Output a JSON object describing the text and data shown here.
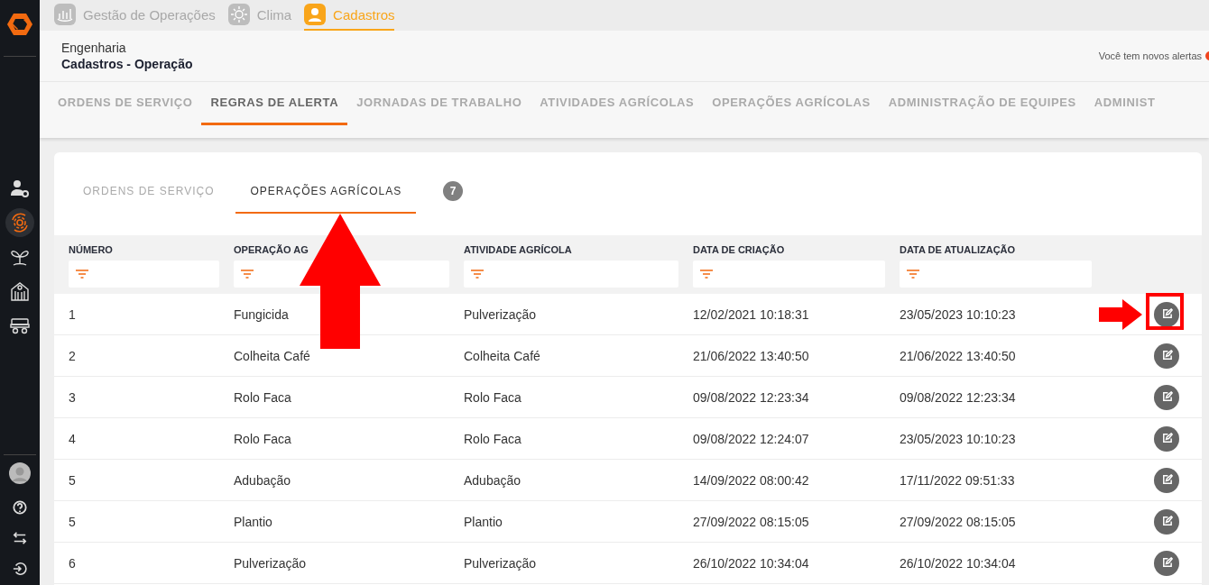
{
  "app_tabs": [
    {
      "label": "Gestão de Operações",
      "kind": "chart",
      "selected": false
    },
    {
      "label": "Clima",
      "kind": "sun",
      "selected": false
    },
    {
      "label": "Cadastros",
      "kind": "person",
      "selected": true
    }
  ],
  "header": {
    "subtitle": "Engenharia",
    "title": "Cadastros - Operação",
    "alert_text": "Você tem novos alertas"
  },
  "nav_tabs": [
    {
      "label": "ORDENS DE SERVIÇO",
      "selected": false
    },
    {
      "label": "REGRAS DE ALERTA",
      "selected": true
    },
    {
      "label": "JORNADAS DE TRABALHO",
      "selected": false
    },
    {
      "label": "ATIVIDADES AGRÍCOLAS",
      "selected": false
    },
    {
      "label": "OPERAÇÕES AGRÍCOLAS",
      "selected": false
    },
    {
      "label": "ADMINISTRAÇÃO DE EQUIPES",
      "selected": false
    },
    {
      "label": "ADMINIST",
      "selected": false
    }
  ],
  "sidebar": {
    "items": [
      {
        "kind": "user-gear",
        "selected": false
      },
      {
        "kind": "gear-cycle",
        "selected": true
      },
      {
        "kind": "plant",
        "selected": false
      },
      {
        "kind": "building",
        "selected": false
      },
      {
        "kind": "vehicle",
        "selected": false
      }
    ],
    "bottom": [
      {
        "kind": "avatar"
      },
      {
        "kind": "help"
      },
      {
        "kind": "swap"
      },
      {
        "kind": "logout"
      }
    ]
  },
  "card_tabs": [
    {
      "label": "ORDENS DE SERVIÇO",
      "selected": false
    },
    {
      "label": "OPERAÇÕES AGRÍCOLAS",
      "selected": true
    }
  ],
  "count_badge": "7",
  "table": {
    "columns": [
      "NÚMERO",
      "OPERAÇÃO AG",
      "ATIVIDADE AGRÍCOLA",
      "DATA DE CRIAÇÃO",
      "DATA DE ATUALIZAÇÃO"
    ],
    "rows": [
      [
        "1",
        "Fungicida",
        "Pulverização",
        "12/02/2021 10:18:31",
        "23/05/2023 10:10:23"
      ],
      [
        "2",
        "Colheita Café",
        "Colheita Café",
        "21/06/2022 13:40:50",
        "21/06/2022 13:40:50"
      ],
      [
        "3",
        "Rolo Faca",
        "Rolo Faca",
        "09/08/2022 12:23:34",
        "09/08/2022 12:23:34"
      ],
      [
        "4",
        "Rolo Faca",
        "Rolo Faca",
        "09/08/2022 12:24:07",
        "23/05/2023 10:10:23"
      ],
      [
        "5",
        "Adubação",
        "Adubação",
        "14/09/2022 08:00:42",
        "17/11/2022 09:51:33"
      ],
      [
        "5",
        "Plantio",
        "Plantio",
        "27/09/2022 08:15:05",
        "27/09/2022 08:15:05"
      ],
      [
        "6",
        "Pulverização",
        "Pulverização",
        "26/10/2022 10:34:04",
        "26/10/2022 10:34:04"
      ]
    ]
  },
  "annotations": [
    {
      "kind": "arrow-up"
    },
    {
      "kind": "arrow-right"
    },
    {
      "kind": "highlight-box"
    }
  ]
}
